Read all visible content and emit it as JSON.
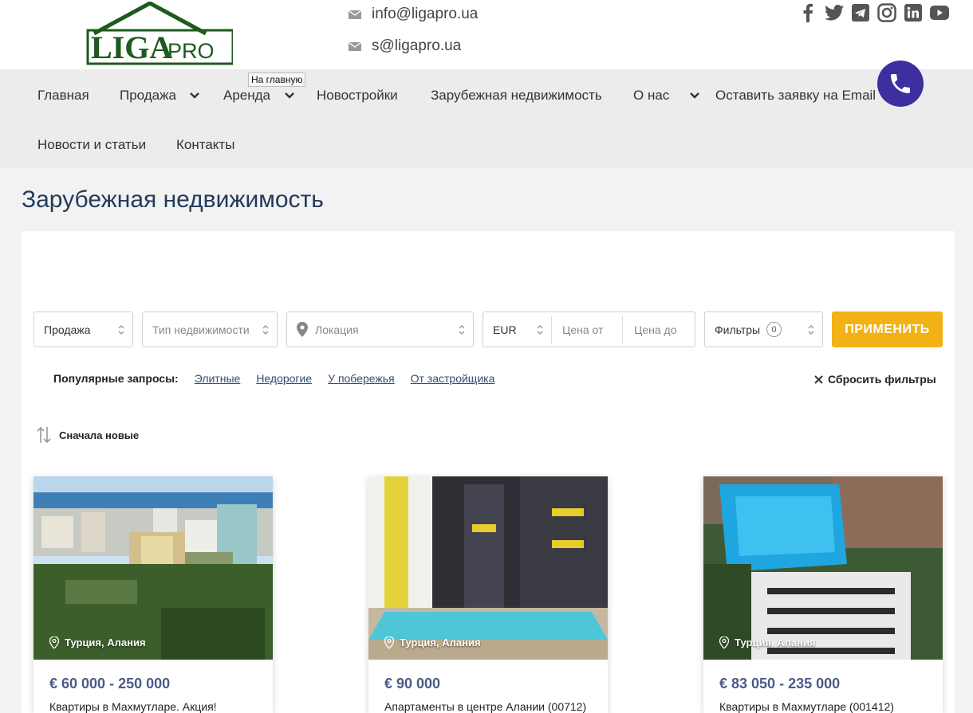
{
  "header": {
    "logo_text_main": "LIGA",
    "logo_text_sub": "PRO",
    "emails": [
      "info@ligapro.ua",
      "s@ligapro.ua"
    ],
    "socials": [
      "facebook-icon",
      "twitter-icon",
      "telegram-icon",
      "instagram-icon",
      "linkedin-icon",
      "youtube-icon"
    ]
  },
  "nav": {
    "items": [
      {
        "label": "Главная",
        "dropdown": false
      },
      {
        "label": "Продажа",
        "dropdown": true
      },
      {
        "label": "Аренда",
        "dropdown": true
      },
      {
        "label": "Новостройки",
        "dropdown": false
      },
      {
        "label": "Зарубежная недвижимость",
        "dropdown": false
      },
      {
        "label": "О нас",
        "dropdown": true
      },
      {
        "label": "Оставить заявку на Email",
        "dropdown": false
      },
      {
        "label": "Новости и статьи",
        "dropdown": false
      },
      {
        "label": "Контакты",
        "dropdown": false
      }
    ],
    "tooltip": "На главную"
  },
  "page": {
    "title": "Зарубежная недвижимость"
  },
  "filters": {
    "deal_type": "Продажа",
    "property_type_placeholder": "Тип недвижимости",
    "location_placeholder": "Локация",
    "currency": "EUR",
    "price_from_placeholder": "Цена от",
    "price_to_placeholder": "Цена до",
    "filters_label": "Фильтры",
    "filters_count": "0",
    "apply_label": "ПРИМЕНИТЬ"
  },
  "popular": {
    "label": "Популярные запросы:",
    "links": [
      "Элитные",
      "Недорогие",
      "У побережья",
      "От застройщика"
    ],
    "reset_label": "Сбросить фильтры"
  },
  "sort": {
    "label": "Сначала новые"
  },
  "cards": [
    {
      "location": "Турция, Алания",
      "price": "€ 60 000 - 250 000",
      "name": "Квартиры в Махмутларе. Акция!"
    },
    {
      "location": "Турция, Алания",
      "price": "€ 90 000",
      "name": "Апартаменты в центре Алании (00712)"
    },
    {
      "location": "Турция, Алания",
      "price": "€ 83 050 - 235 000",
      "name": "Квартиры в Махмутларе (001412)"
    }
  ],
  "colors": {
    "accent_button": "#f2b215",
    "phone_button": "#3d2fa0",
    "logo_green": "#1d5a1d",
    "price": "#4b5a86"
  }
}
